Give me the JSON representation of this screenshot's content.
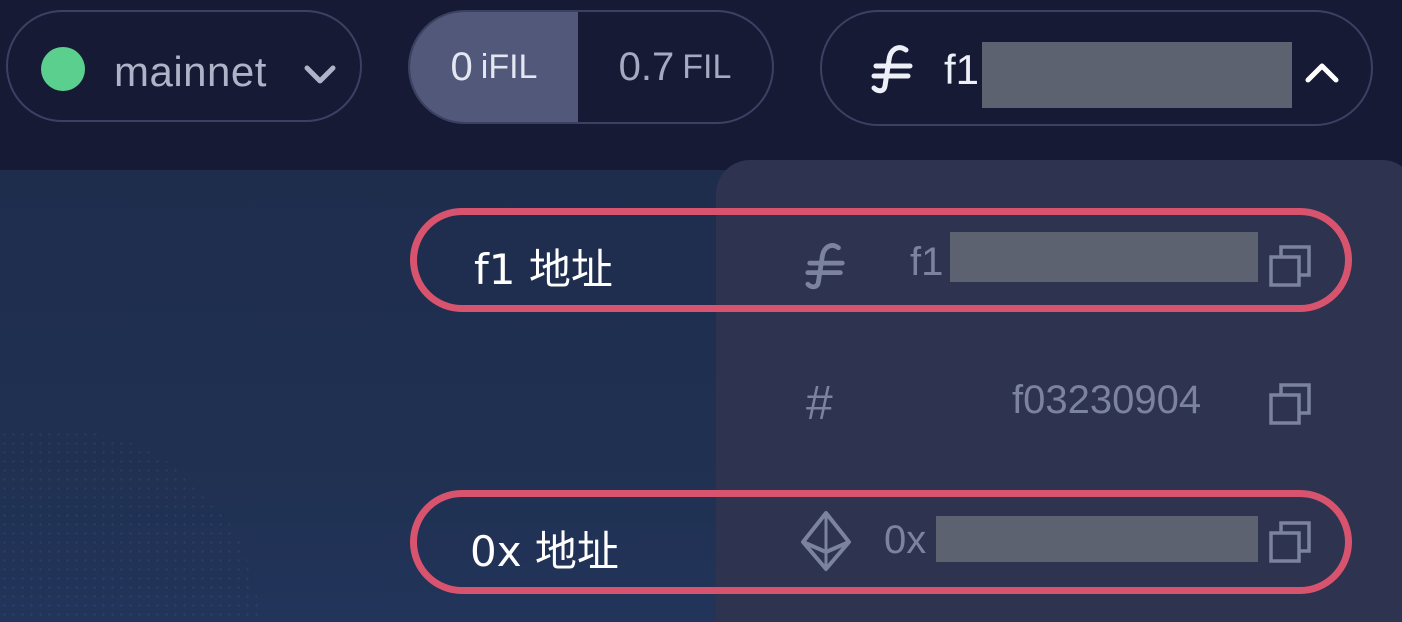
{
  "network": {
    "label": "mainnet",
    "status_color": "#5bd08e",
    "icon": "chevron-down-icon"
  },
  "balances": [
    {
      "amount": "0",
      "unit": "iFIL",
      "selected": true
    },
    {
      "amount": "0.7",
      "unit": "FIL",
      "selected": false
    }
  ],
  "account": {
    "prefix": "f1",
    "icon": "filecoin-icon",
    "toggle_icon": "chevron-up-icon"
  },
  "address_menu": {
    "rows": [
      {
        "icon": "filecoin-icon",
        "value_prefix": "f1",
        "copy_icon": "copy-icon"
      },
      {
        "icon": "hash-icon",
        "symbol": "#",
        "value": "f03230904",
        "copy_icon": "copy-icon"
      },
      {
        "icon": "ethereum-icon",
        "value_prefix": "0x",
        "copy_icon": "copy-icon"
      }
    ]
  },
  "annotations": {
    "f1_label": "f1 地址",
    "ox_label": "0x 地址",
    "highlight_color": "#d8546e"
  },
  "colors": {
    "background": "#161a35",
    "panel": "#2e3350",
    "redaction": "#5d6270"
  }
}
